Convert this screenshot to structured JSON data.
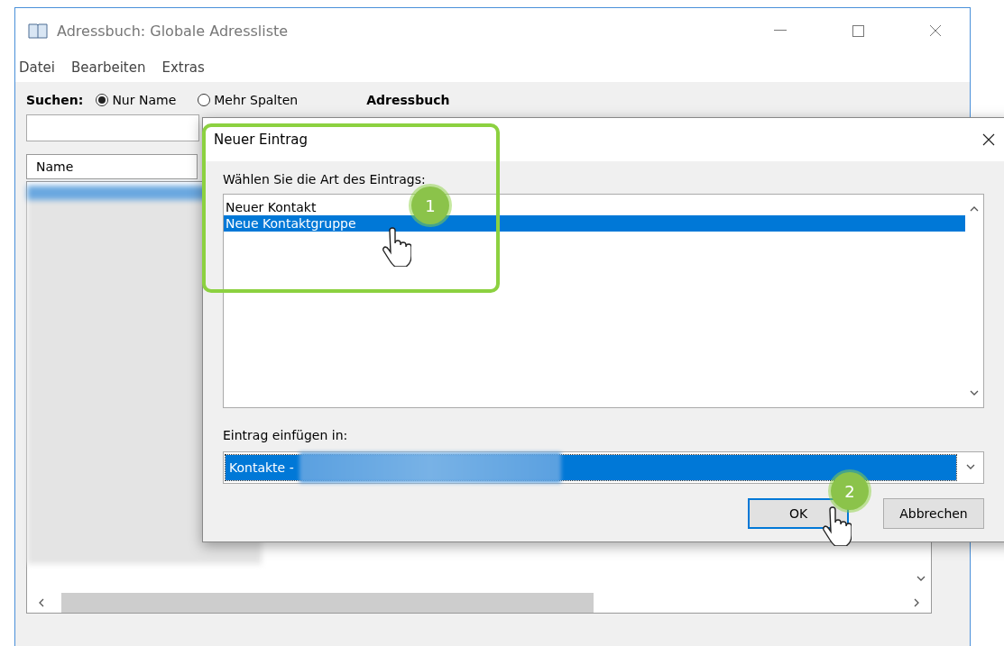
{
  "main_window": {
    "title": "Adressbuch: Globale Adressliste",
    "menu": [
      "Datei",
      "Bearbeiten",
      "Extras"
    ],
    "search": {
      "label": "Suchen:",
      "options": [
        {
          "label": "Nur Name",
          "selected": true
        },
        {
          "label": "Mehr Spalten",
          "selected": false
        }
      ]
    },
    "address_book_label": "Adressbuch",
    "table": {
      "columns": [
        "Name"
      ]
    }
  },
  "dialog": {
    "title": "Neuer Eintrag",
    "type_label": "Wählen Sie die Art des Eintrags:",
    "entry_types": [
      {
        "label": "Neuer Kontakt",
        "selected": false
      },
      {
        "label": "Neue Kontaktgruppe",
        "selected": true
      }
    ],
    "insert_label": "Eintrag einfügen in:",
    "insert_value": "Kontakte -",
    "buttons": [
      {
        "label": "OK",
        "focused": true
      },
      {
        "label": "Abbrechen",
        "focused": false
      }
    ]
  },
  "annotations": [
    {
      "label": "1"
    },
    {
      "label": "2"
    }
  ]
}
